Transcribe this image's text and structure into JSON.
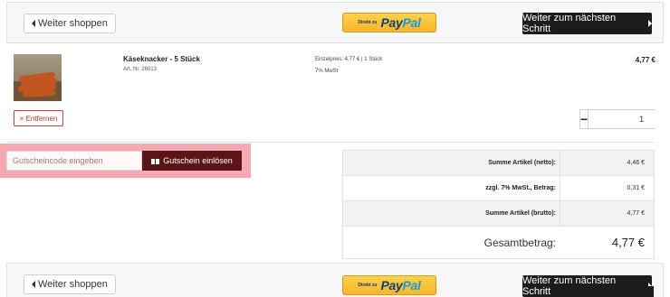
{
  "actionbar": {
    "back_label": "Weiter shoppen",
    "paypal_prefix": "Direkt zu",
    "paypal_pay": "Pay",
    "paypal_pal": "Pal",
    "next_label": "Weiter zum nächsten Schritt"
  },
  "product": {
    "name": "Käseknacker - 5 Stück",
    "art_nr": "Art. Nr. 26013",
    "unit_price": "Einzelpreis: 4,77 € | 1 Stück",
    "vat_note": "7% MwSt",
    "line_total": "4,77 €",
    "remove_label": "× Entfernen",
    "quantity": "1",
    "qty_minus": "−",
    "qty_plus": "+"
  },
  "voucher": {
    "placeholder": "Gutscheincode eingeben",
    "button_label": "Gutschein einlösen"
  },
  "summary": {
    "rows": [
      {
        "label": "Summe Artikel (netto):",
        "value": "4,46 €"
      },
      {
        "label": "zzgl. 7% MwSt., Betrag:",
        "value": "0,31 €"
      },
      {
        "label": "Summe Artikel (brutto):",
        "value": "4,77 €"
      }
    ],
    "total_label": "Gesamtbetrag:",
    "total_value": "4,77 €"
  },
  "colors": {
    "primary_button": "#1c1c1c",
    "voucher_button": "#5a1616",
    "voucher_highlight": "#f6a9b3",
    "remove_accent": "#d33a3a",
    "paypal_yellow": "#f7b52c"
  }
}
